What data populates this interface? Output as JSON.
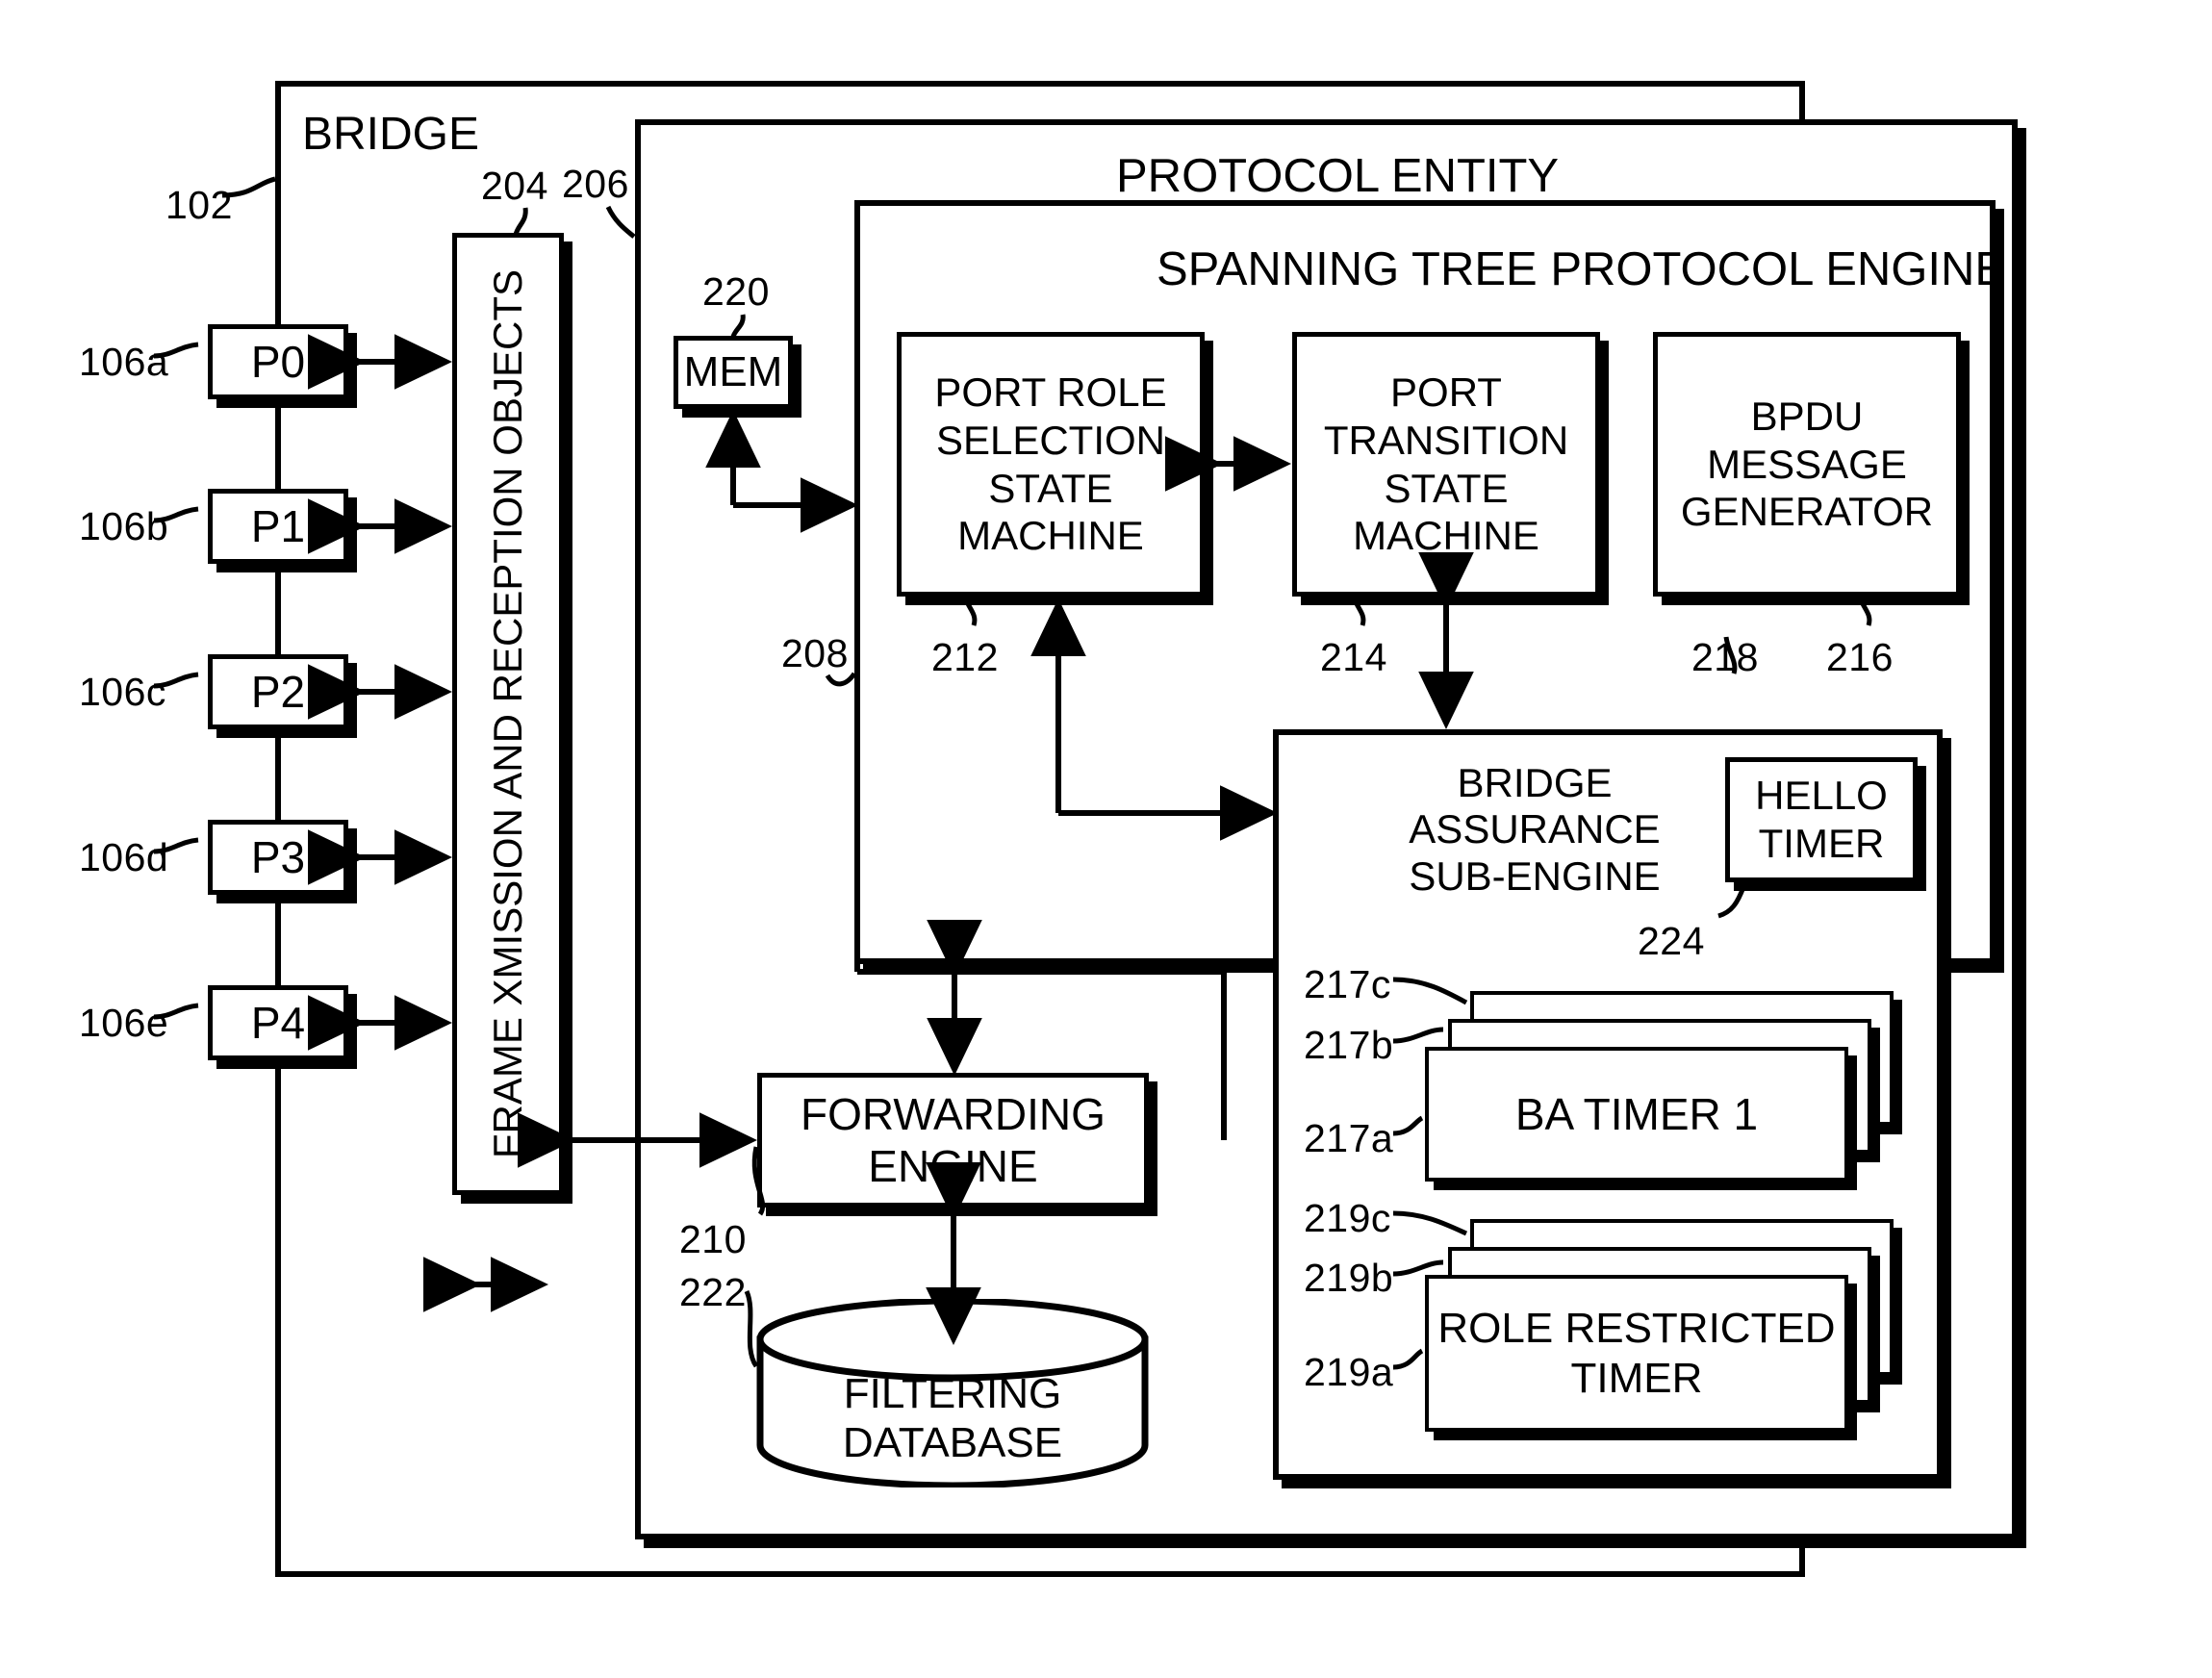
{
  "figure": {
    "outer_label": "BRIDGE",
    "outer_ref": "102",
    "protocol_entity_title": "PROTOCOL ENTITY",
    "protocol_entity_ref": "206",
    "stp_engine_title": "SPANNING TREE PROTOCOL ENGINE",
    "stp_engine_ref": "208"
  },
  "ports": [
    {
      "label": "P0",
      "ref": "106a"
    },
    {
      "label": "P1",
      "ref": "106b"
    },
    {
      "label": "P2",
      "ref": "106c"
    },
    {
      "label": "P3",
      "ref": "106d"
    },
    {
      "label": "P4",
      "ref": "106e"
    }
  ],
  "frame_objects": {
    "label": "FRAME XMISSION AND RECEPTION OBJECTS",
    "ref": "204"
  },
  "mem": {
    "label": "MEM",
    "ref": "220"
  },
  "engines": [
    {
      "label": "PORT ROLE\nSELECTION\nSTATE\nMACHINE",
      "ref": "212"
    },
    {
      "label": "PORT\nTRANSITION\nSTATE\nMACHINE",
      "ref": "214"
    },
    {
      "label": "BPDU\nMESSAGE\nGENERATOR",
      "ref": "216"
    }
  ],
  "bridge_assurance": {
    "label": "BRIDGE\nASSURANCE\nSUB-ENGINE",
    "ref": "218",
    "hello_timer": {
      "label": "HELLO\nTIMER",
      "ref": "224"
    },
    "ba_timers": {
      "label": "BA TIMER 1",
      "refs": [
        "217c",
        "217b",
        "217a"
      ]
    },
    "role_restricted_timers": {
      "label": "ROLE RESTRICTED\nTIMER",
      "refs": [
        "219c",
        "219b",
        "219a"
      ]
    }
  },
  "forwarding_engine": {
    "label": "FORWARDING\nENGINE",
    "ref": "210"
  },
  "filtering_database": {
    "label": "FILTERING\nDATABASE",
    "ref": "222"
  },
  "colors": {
    "ink": "#000000",
    "paper": "#ffffff"
  }
}
